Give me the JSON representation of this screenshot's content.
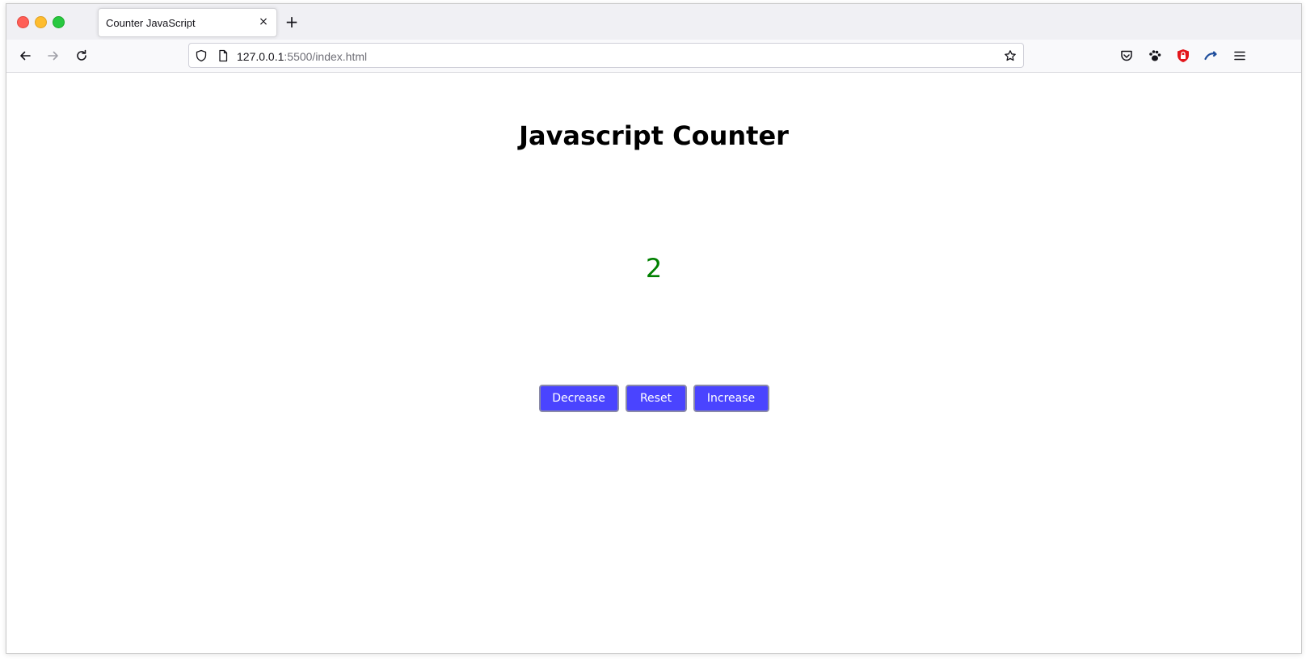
{
  "browser": {
    "tab": {
      "title": "Counter JavaScript",
      "close_glyph": "×"
    },
    "new_tab_glyph": "+",
    "url": {
      "host": "127.0.0.1",
      "rest": ":5500/index.html"
    }
  },
  "page": {
    "title": "Javascript Counter",
    "count": "2",
    "count_color": "#008000",
    "buttons": {
      "decrease": "Decrease",
      "reset": "Reset",
      "increase": "Increase"
    },
    "button_color": "#4a44ff"
  },
  "icons": {
    "nav": [
      "back-arrow-icon",
      "forward-arrow-icon",
      "reload-icon"
    ],
    "url": [
      "shield-icon",
      "page-icon",
      "bookmark-star-icon"
    ],
    "toolbar": [
      "pocket-icon",
      "extension-paw-icon",
      "ublock-shield-icon",
      "extension-wave-icon",
      "hamburger-menu-icon"
    ]
  }
}
